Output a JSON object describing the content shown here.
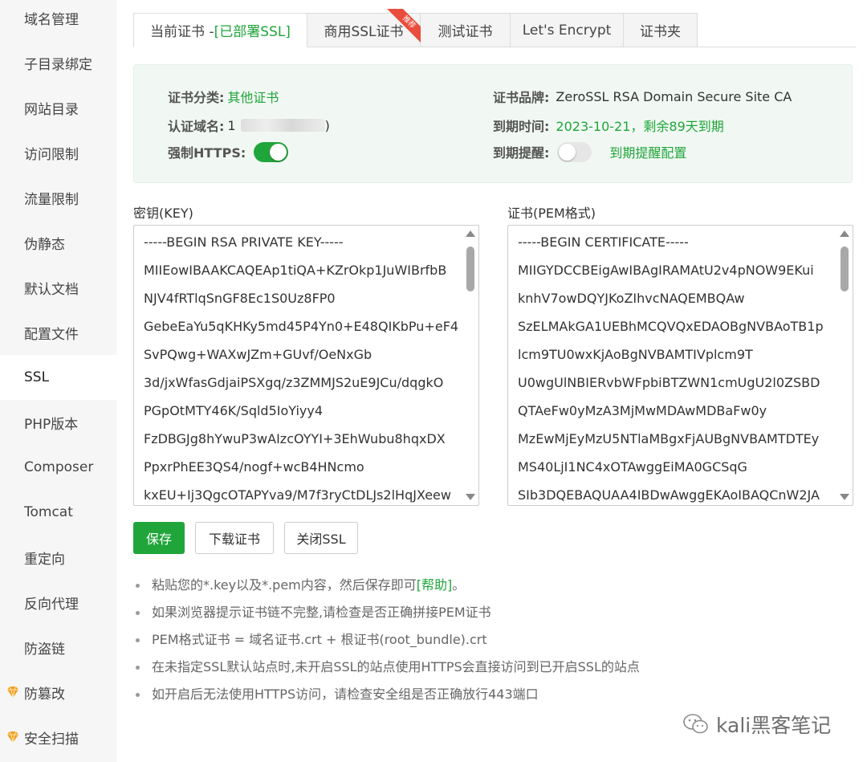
{
  "sidebar": {
    "items": [
      {
        "label": "域名管理"
      },
      {
        "label": "子目录绑定"
      },
      {
        "label": "网站目录"
      },
      {
        "label": "访问限制"
      },
      {
        "label": "流量限制"
      },
      {
        "label": "伪静态"
      },
      {
        "label": "默认文档"
      },
      {
        "label": "配置文件"
      },
      {
        "label": "SSL"
      },
      {
        "label": "PHP版本"
      },
      {
        "label": "Composer"
      },
      {
        "label": "Tomcat"
      },
      {
        "label": "重定向"
      },
      {
        "label": "反向代理"
      },
      {
        "label": "防盗链"
      },
      {
        "label": "防篡改"
      },
      {
        "label": "安全扫描"
      }
    ],
    "active": "SSL"
  },
  "tabs": {
    "current_prefix": "当前证书 - ",
    "current_status": "[已部署SSL]",
    "commercial": "商用SSL证书",
    "commercial_badge": "推荐",
    "test": "测试证书",
    "letsencrypt": "Let's Encrypt",
    "folder": "证书夹"
  },
  "info": {
    "category_label": "证书分类:",
    "category_value": "其他证书",
    "domain_label": "认证域名:",
    "domain_prefix": "1",
    "domain_suffix": ")",
    "https_label": "强制HTTPS:",
    "https_enabled": true,
    "brand_label": "证书品牌:",
    "brand_value": "ZeroSSL RSA Domain Secure Site CA",
    "expire_label": "到期时间:",
    "expire_value": "2023-10-21，剩余89天到期",
    "reminder_label": "到期提醒:",
    "reminder_enabled": false,
    "reminder_link": "到期提醒配置"
  },
  "key_box": {
    "label": "密钥(KEY)",
    "lines": [
      "-----BEGIN RSA PRIVATE KEY-----",
      "MIIEowIBAAKCAQEAp1tiQA+KZrOkp1JuWIBrfbB",
      "NJV4fRTlqSnGF8Ec1S0Uz8FP0",
      "GebeEaYu5qKHKy5md45P4Yn0+E48QIKbPu+eF4",
      "SvPQwg+WAXwJZm+GUvf/OeNxGb",
      "3d/jxWfasGdjaiPSXgq/z3ZMMJS2uE9JCu/dqgkO",
      "PGpOtMTY46K/Sqld5IoYiyy4",
      "FzDBGJg8hYwuP3wAIzcOYYI+3EhWubu8hqxDX",
      "PpxrPhEE3QS4/nogf+wcB4HNcmo",
      "kxEU+Ij3QgcOTAPYva9/M7f3ryCtDLJs2lHqJXeew"
    ]
  },
  "cert_box": {
    "label": "证书(PEM格式)",
    "lines": [
      "-----BEGIN CERTIFICATE-----",
      "MIIGYDCCBEigAwIBAgIRAMAtU2v4pNOW9EKui",
      "knhV7owDQYJKoZIhvcNAQEMBQAw",
      "SzELMAkGA1UEBhMCQVQxEDAOBgNVBAoTB1p",
      "lcm9TU0wxKjAoBgNVBAMTIVplcm9T",
      "U0wgUlNBIERvbWFpbiBTZWN1cmUgU2l0ZSBD",
      "QTAeFw0yMzA3MjMwMDAwMDBaFw0y",
      "MzEwMjEyMzU5NTlaMBgxFjAUBgNVBAMTDTEy",
      "MS40LjI1NC4xOTAwggEiMA0GCSqG",
      "SIb3DQEBAQUAA4IBDwAwggEKAoIBAQCnW2JA"
    ]
  },
  "buttons": {
    "save": "保存",
    "download": "下载证书",
    "close_ssl": "关闭SSL"
  },
  "tips": {
    "tip1_text": "粘贴您的*.key以及*.pem内容，然后保存即可",
    "tip1_help": "[帮助]",
    "tip1_end": "。",
    "tip2": "如果浏览器提示证书链不完整,请检查是否正确拼接PEM证书",
    "tip3": "PEM格式证书 = 域名证书.crt + 根证书(root_bundle).crt",
    "tip4": "在未指定SSL默认站点时,未开启SSL的站点使用HTTPS会直接访问到已开启SSL的站点",
    "tip5": "如开启后无法使用HTTPS访问，请检查安全组是否正确放行443端口"
  },
  "watermark": {
    "text": "kali黑客笔记"
  },
  "colors": {
    "accent": "#20a53a",
    "info_bg": "#f1f8f3",
    "badge": "#e84d3d"
  }
}
